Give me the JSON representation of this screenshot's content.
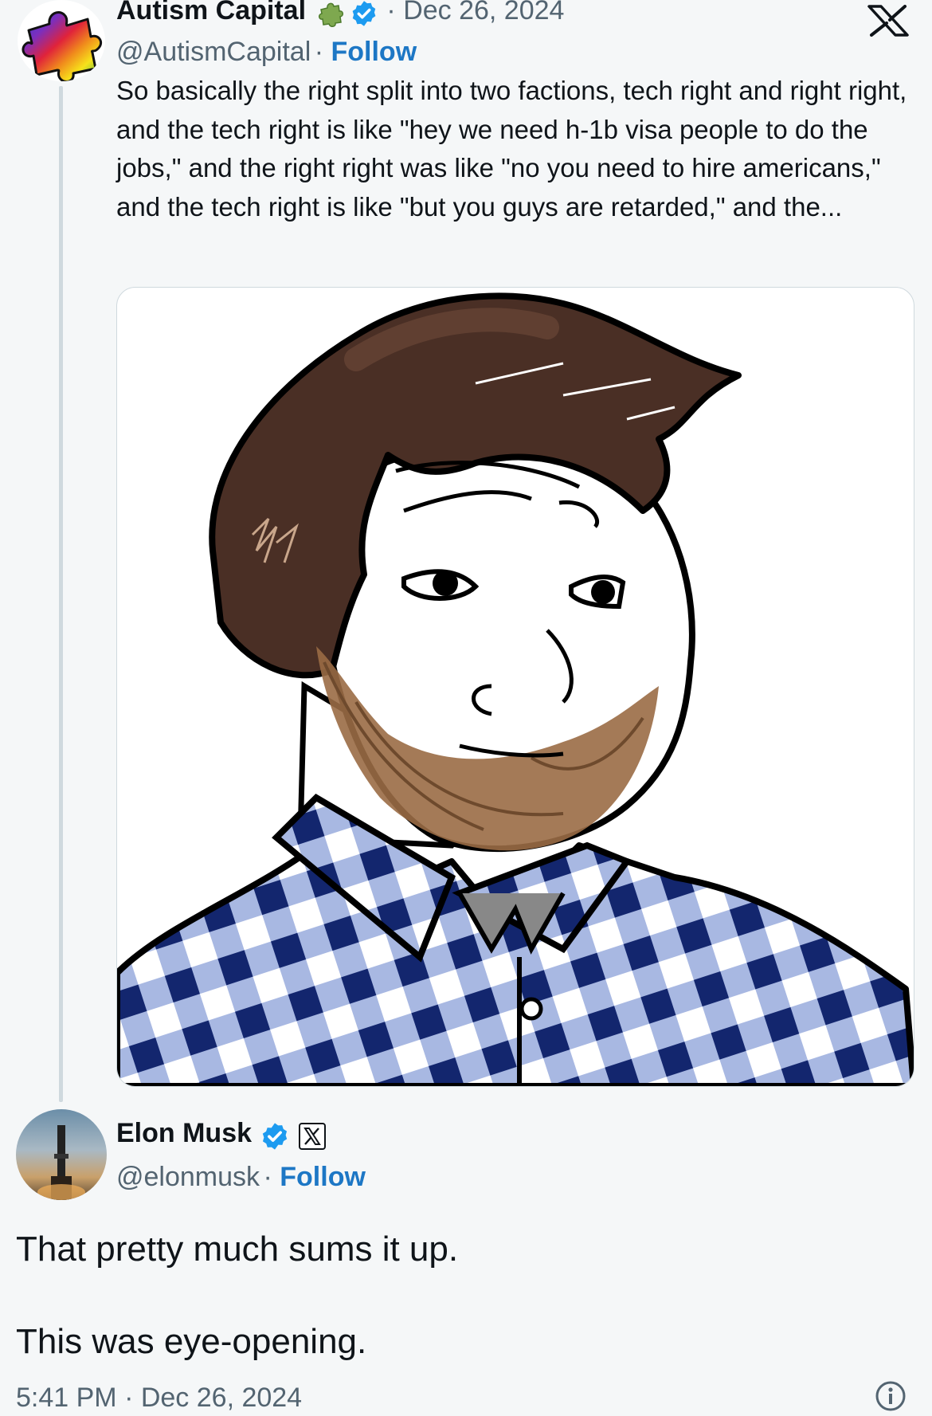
{
  "tweet": {
    "author": {
      "name": "Autism Capital",
      "handle": "@AutismCapital",
      "verified": true
    },
    "date_sep": "·",
    "date": "Dec 26, 2024",
    "follow_label": "Follow",
    "text": "So basically the right split into two factions, tech right and right right, and the tech right is like \"hey we need h-1b visa people to do the jobs,\" and the right right was like \"no you need to hire americans,\" and the tech right is like  \"but you guys are retarded,\" and the...",
    "media": {
      "alt_icon": "wojak-meme-image"
    }
  },
  "reply": {
    "author": {
      "name": "Elon Musk",
      "handle": "@elonmusk",
      "verified": true
    },
    "sep": "·",
    "follow_label": "Follow",
    "line1": "That pretty much sums it up.",
    "line2": "This was eye-opening.",
    "timestamp": "5:41 PM · Dec 26, 2024"
  },
  "colors": {
    "background": "#f5f7f8",
    "accent": "#1d77c5",
    "verified": "#1d9bf0",
    "muted": "#536471"
  },
  "icons": {
    "x_logo": "x-logo-icon",
    "verified": "verified-badge-icon",
    "info": "info-icon"
  }
}
